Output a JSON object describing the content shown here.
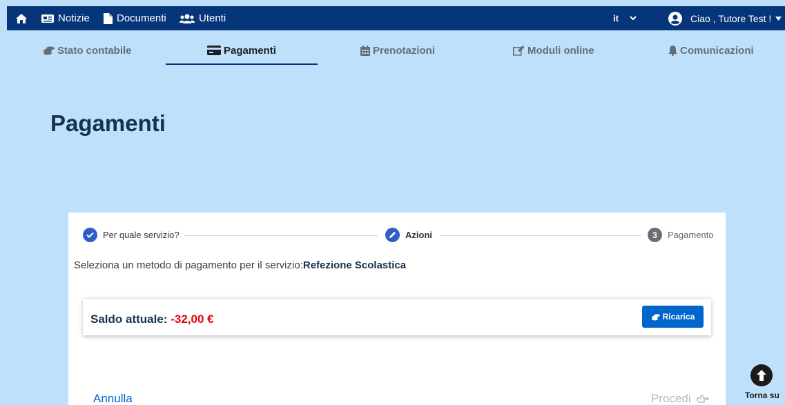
{
  "navbar": {
    "items": [
      {
        "label": "Notizie"
      },
      {
        "label": "Documenti"
      },
      {
        "label": "Utenti"
      }
    ],
    "language": "it",
    "greeting": "Ciao , Tutore Test !"
  },
  "tabs": [
    {
      "label": "Stato contabile"
    },
    {
      "label": "Pagamenti"
    },
    {
      "label": "Prenotazioni"
    },
    {
      "label": "Moduli online"
    },
    {
      "label": "Comunicazioni"
    }
  ],
  "page": {
    "title": "Pagamenti"
  },
  "stepper": [
    {
      "label": "Per quale servizio?"
    },
    {
      "label": "Azioni"
    },
    {
      "number": "3",
      "label": "Pagamento"
    }
  ],
  "instruction": {
    "text": "Seleziona un metodo di pagamento per il servizio:",
    "service": "Refezione Scolastica"
  },
  "balance": {
    "label": "Saldo attuale:",
    "value": "-32,00 €",
    "button": "Ricarica"
  },
  "footer": {
    "cancel": "Annulla",
    "proceed": "Procedi",
    "scroll_top": "Torna su"
  },
  "colors": {
    "navbar": "#06357a",
    "background": "#bfe0fb",
    "accent": "#0066cc",
    "negative": "#e3000f"
  }
}
